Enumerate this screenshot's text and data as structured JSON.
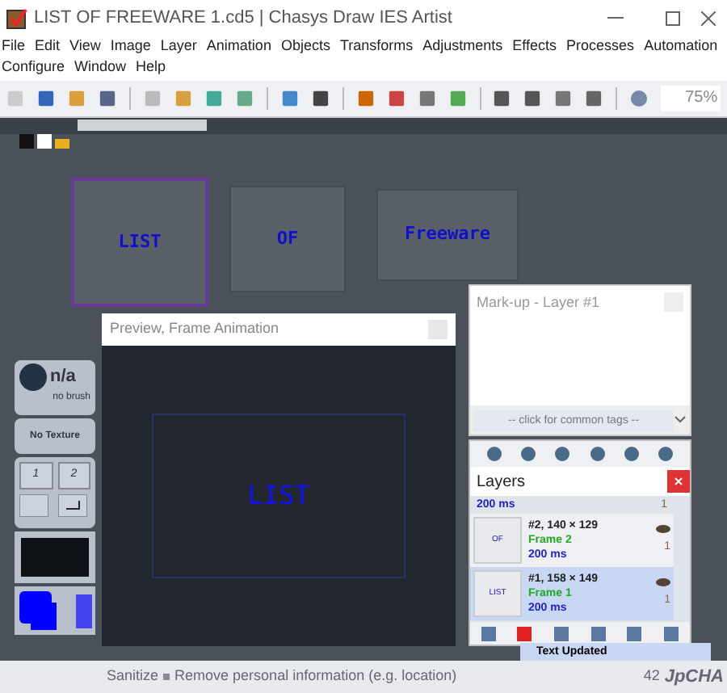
{
  "window": {
    "title": "LIST OF FREEWARE 1.cd5 | Chasys Draw IES Artist"
  },
  "menu_rows": [
    [
      "File",
      "Edit",
      "View",
      "Image",
      "Layer",
      "Animation",
      "Objects",
      "Transforms",
      "Adjustments",
      "Effects",
      "Processes",
      "Automation"
    ],
    [
      "Configure",
      "Window",
      "Help"
    ]
  ],
  "toolbar": {
    "zoom": "75%"
  },
  "canvas": {
    "frames": [
      {
        "text": "LIST",
        "selected": true
      },
      {
        "text": "OF",
        "selected": false
      },
      {
        "text": "Freeware",
        "selected": false
      }
    ]
  },
  "tool_panel": {
    "brush": "n/a",
    "brush_note": "no brush",
    "texture": "No Texture",
    "keys": [
      "1",
      "2"
    ]
  },
  "preview": {
    "title": "Preview, Frame Animation",
    "frame_text": "LIST"
  },
  "markup": {
    "title": "Mark-up - Layer #1",
    "placeholder": "-- click for common tags --"
  },
  "layers": {
    "title": "Layers",
    "partial_item": {
      "duration": "200 ms",
      "count": "1"
    },
    "items": [
      {
        "thumb": "OF",
        "name": "#2, 140 × 129",
        "frame": "Frame 2",
        "duration": "200 ms",
        "count": "1",
        "selected": false
      },
      {
        "thumb": "LIST",
        "name": "#1, 158 × 149",
        "frame": "Frame 1",
        "duration": "200 ms",
        "count": "1",
        "selected": true
      }
    ]
  },
  "history": {
    "item": "Text Updated"
  },
  "status_bar": {
    "label": "Sanitize",
    "message": "Remove personal information (e.g. location)",
    "count": "42",
    "brand": "JpCHA"
  }
}
